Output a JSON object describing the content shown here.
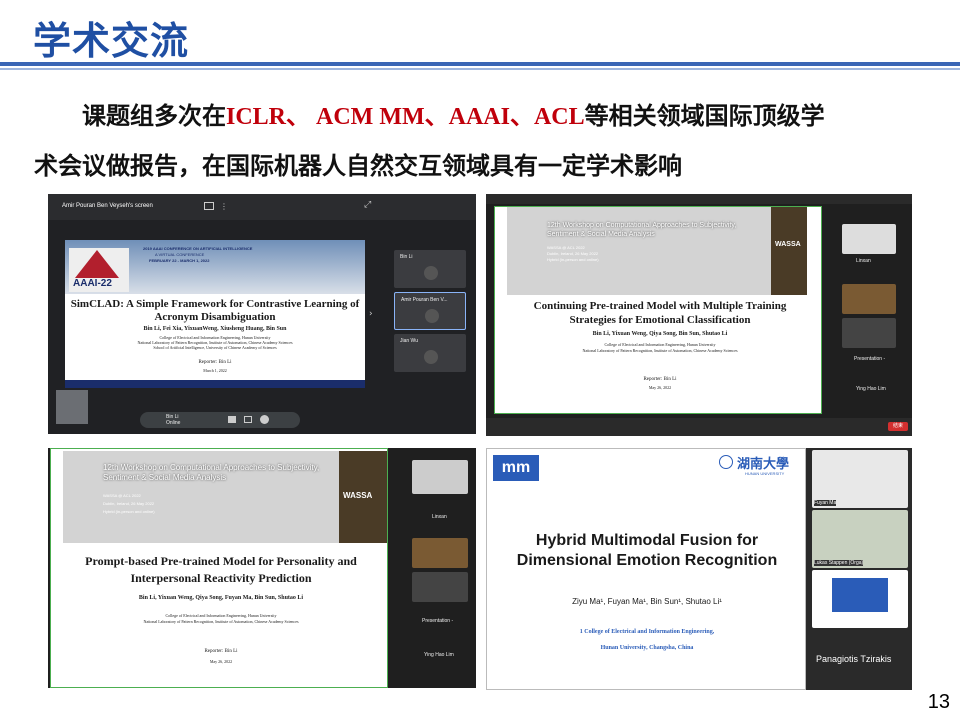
{
  "header": {
    "title": "学术交流"
  },
  "body_text": {
    "line1_pre": "课题组多次在",
    "line1_venues": "ICLR、 ACM MM、AAAI、ACL",
    "line1_post": "等相关领域国际顶级学",
    "line2": "术会议做报告，在国际机器人自然交互领域具有一定学术影响"
  },
  "page_number": "13",
  "shot1": {
    "presenter_bar": "Amir Pouran Ben Veyseh's screen",
    "conf_logo": "AAAI-22",
    "conf_header": "2019 AAAI CONFERENCE ON ARTIFICIAL INTELLIGENCE",
    "conf_sub": "A VIRTUAL CONFERENCE",
    "conf_dates": "FEBRUARY 22 - MARCH 1, 2022",
    "paper_title": "SimCLAD: A Simple Framework for Contrastive Learning of Acronym Disambiguation",
    "authors": "Bin Li, Fei Xia, YixuanWeng, Xiusheng Huang, Bin Sun",
    "affil1": "College of Electrical and Information Engineering, Hunan University",
    "affil2": "National Laboratory of Pattern Recognition, Institute of Automation, Chinese Academy Sciences",
    "affil3": "School of Artificial Intelligence, University of Chinese Academy of Sciences",
    "reporter": "Reporter: Bin Li",
    "date": "March 1, 2022",
    "participant1": "Bin Li",
    "participant2": "Amir Pouran Ben V...",
    "participant3": "Jian Wu",
    "me_name": "Bin Li",
    "me_status": "Online"
  },
  "shot2": {
    "workshop": "12th Workshop on Computational Approaches to Subjectivity, Sentiment & Social Media Analysis",
    "wassa": "WASSA",
    "meta1": "WASSA @ ACL 2022",
    "meta2": "Dublin, Ireland, 26 May 2022",
    "meta3": "Hybrid (in-person and online)",
    "paper_title": "Continuing Pre-trained Model with Multiple Training Strategies for Emotional Classification",
    "authors": "Bin Li, Yixuan Weng, Qiya Song, Bin Sun, Shutao Li",
    "affil1": "College of Electrical and Information Engineering, Hunan University",
    "affil2": "National Laboratory of Pattern Recognition, Institute of Automation, Chinese Academy Sciences",
    "reporter": "Reporter: Bin Li",
    "date": "May 26, 2022",
    "p1": "Linxan",
    "p2": "Presentation -",
    "p3": "Ying Hao Lim",
    "end_button": "结束"
  },
  "shot3": {
    "workshop": "12th Workshop on Computational Approaches to Subjectivity, Sentiment & Social Media Analysis",
    "wassa": "WASSA",
    "meta1": "WASSA @ ACL 2022",
    "meta2": "Dublin, Ireland, 26 May 2022",
    "meta3": "Hybrid (in-person and online)",
    "paper_title": "Prompt-based Pre-trained Model for Personality and Interpersonal Reactivity Prediction",
    "authors": "Bin Li, Yixuan Weng, Qiya Song, Fuyan Ma, Bin Sun, Shutao Li",
    "affil1": "College of Electrical and Information Engineering, Hunan University",
    "affil2": "National Laboratory of Pattern Recognition, Institute of Automation, Chinese Academy Sciences",
    "reporter": "Reporter: Bin Li",
    "date": "May 26, 2022",
    "p1": "Linxan",
    "p2": "Presentation -",
    "p3": "Ying Hao Lim"
  },
  "shot4": {
    "acm_logo": "mm",
    "acm_text": "ACM multimedia",
    "univ_cn": "湖南大學",
    "univ_en": "HUNAN UNIVERSITY",
    "paper_title": "Hybrid Multimodal Fusion for Dimensional Emotion Recognition",
    "authors": "Ziyu Ma¹, Fuyan Ma¹, Bin Sun¹, Shutao Li¹",
    "affil1": "1 College of Electrical and Information Engineering,",
    "affil2": "Hunan University, Changsha, China",
    "p1": "Fuyan Ma",
    "p2": "Lukas Stappen (Orga)",
    "p3": "Panagiotis Tzirakis"
  }
}
